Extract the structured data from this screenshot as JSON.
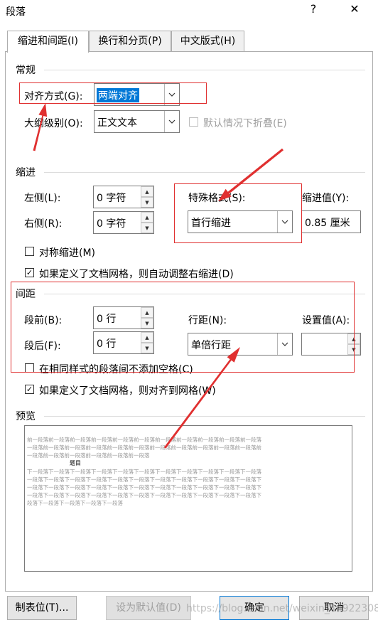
{
  "window": {
    "title": "段落",
    "help_label": "?",
    "close_label": "✕"
  },
  "tabs": [
    {
      "label": "缩进和间距(I)"
    },
    {
      "label": "换行和分页(P)"
    },
    {
      "label": "中文版式(H)"
    }
  ],
  "general": {
    "title": "常规",
    "alignment_label": "对齐方式(G):",
    "alignment_value": "两端对齐",
    "outline_label": "大纲级别(O):",
    "outline_value": "正文文本",
    "collapse_label": "默认情况下折叠(E)"
  },
  "indent": {
    "title": "缩进",
    "left_label": "左侧(L):",
    "left_value": "0 字符",
    "right_label": "右侧(R):",
    "right_value": "0 字符",
    "special_label": "特殊格式(S):",
    "special_value": "首行缩进",
    "by_label": "缩进值(Y):",
    "by_value": "0.85 厘米",
    "mirror_label": "对称缩进(M)",
    "mirror_checked": false,
    "auto_adjust_label": "如果定义了文档网格，则自动调整右缩进(D)",
    "auto_adjust_checked": true
  },
  "spacing": {
    "title": "间距",
    "before_label": "段前(B):",
    "before_value": "0 行",
    "after_label": "段后(F):",
    "after_value": "0 行",
    "line_spacing_label": "行距(N):",
    "line_spacing_value": "单倍行距",
    "at_label": "设置值(A):",
    "at_value": "",
    "no_space_label": "在相同样式的段落间不添加空格(C)",
    "no_space_checked": false,
    "snap_grid_label": "如果定义了文档网格，则对齐到网格(W)",
    "snap_grid_checked": true
  },
  "preview": {
    "title": "预览",
    "prev_lines": [
      "前一段落前一段落前一段落前一段落前一段落前一段落前一段落前一段落前一段落前一段落前一段落",
      "一段落前一段落前一段落前一段落前一段落前一段落前一段落前一段落前一段落前一段落前一段落前",
      "一段落前一段落前一段落前一段落前一段落前一段落"
    ],
    "sample_text": "题目",
    "next_lines": [
      "下一段落下一段落下一段落下一段落下一段落下一段落下一段落下一段落下一段落下一段落下一段落",
      "一段落下一段落下一段落下一段落下一段落下一段落下一段落下一段落下一段落下一段落下一段落下",
      "一段落下一段落下一段落下一段落下一段落下一段落下一段落下一段落下一段落下一段落下一段落下",
      "一段落下一段落下一段落下一段落下一段落下一段落下一段落下一段落下一段落下一段落下一段落下",
      "段落下一段落下一段落下一段落下一段落"
    ]
  },
  "footer": {
    "tabs_button": "制表位(T)...",
    "default_button": "设为默认值(D)",
    "ok_button": "确定",
    "cancel_button": "取消",
    "watermark": "https://blog.csdn.net/weixin_44922308"
  },
  "colors": {
    "annotation_red": "#e03030",
    "selection_blue": "#0078d7"
  }
}
